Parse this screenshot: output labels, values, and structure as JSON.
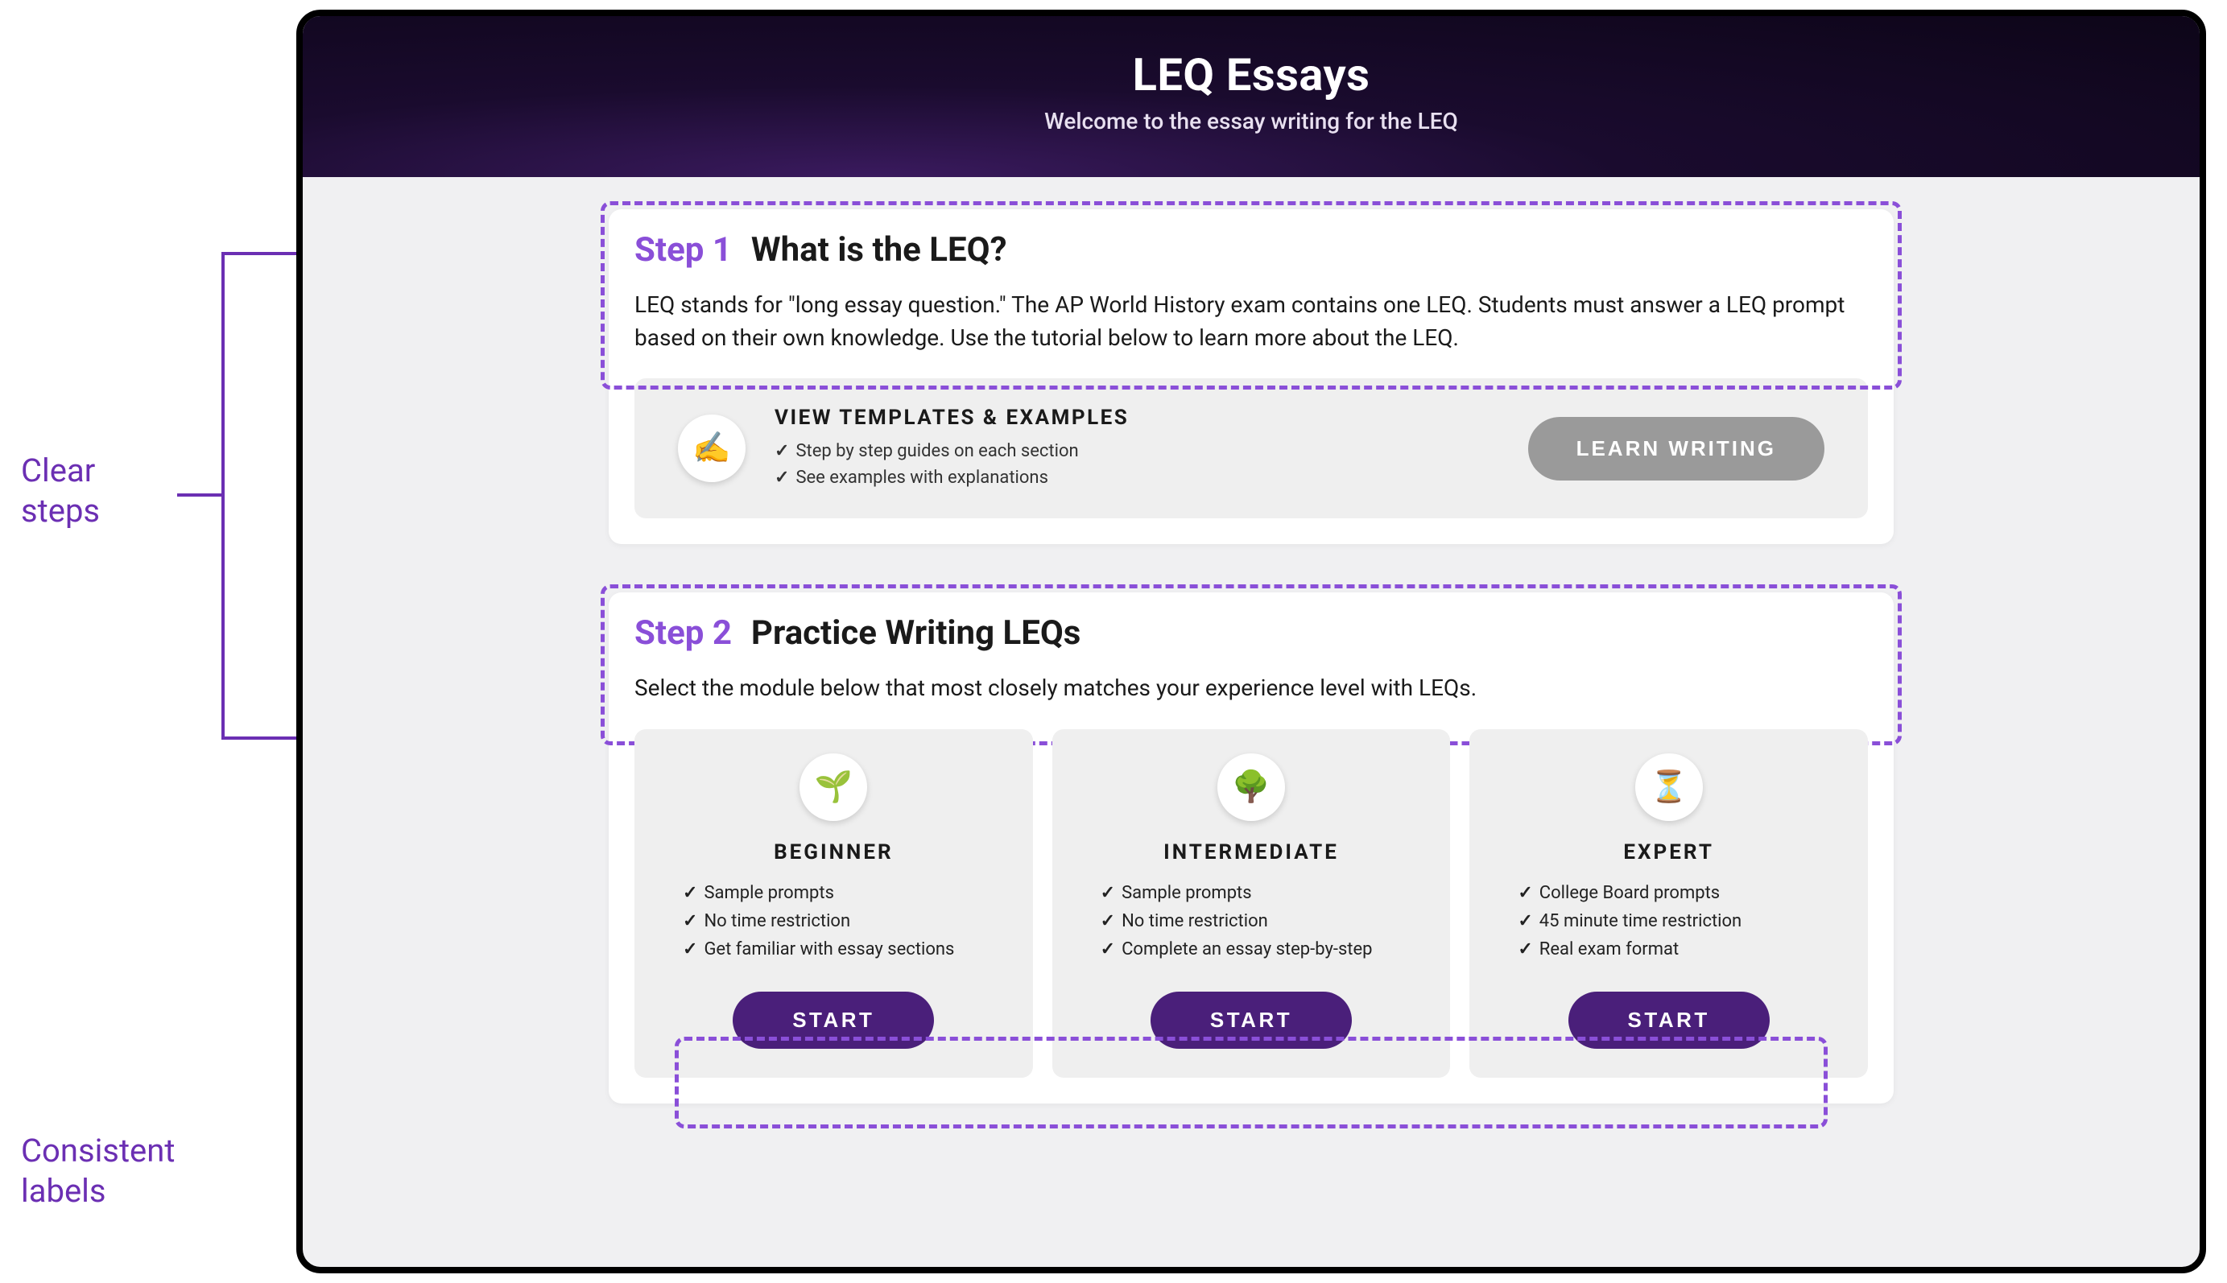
{
  "annotations": {
    "steps_line1": "Clear",
    "steps_line2": "steps",
    "labels_line1": "Consistent",
    "labels_line2": "labels"
  },
  "header": {
    "title": "LEQ Essays",
    "subtitle": "Welcome to the essay writing for the LEQ"
  },
  "step1": {
    "label": "Step 1",
    "title": "What is the LEQ?",
    "desc": "LEQ stands for \"long essay question.\" The AP World History exam contains one LEQ. Students must answer a LEQ prompt based on their own knowledge. Use the tutorial below to learn more about the LEQ.",
    "promo": {
      "icon": "✍️",
      "title": "VIEW TEMPLATES & EXAMPLES",
      "bullet1": "Step by step guides on each section",
      "bullet2": "See examples with explanations",
      "button": "LEARN WRITING"
    }
  },
  "step2": {
    "label": "Step 2",
    "title": "Practice Writing LEQs",
    "desc": "Select the module below that most closely matches your experience level with LEQs.",
    "modules": [
      {
        "icon": "🌱",
        "title": "BEGINNER",
        "bullets": [
          "Sample prompts",
          "No time restriction",
          "Get familiar with essay sections"
        ],
        "button": "START"
      },
      {
        "icon": "🌳",
        "title": "INTERMEDIATE",
        "bullets": [
          "Sample prompts",
          "No time restriction",
          "Complete an essay step-by-step"
        ],
        "button": "START"
      },
      {
        "icon": "⏳",
        "title": "EXPERT",
        "bullets": [
          "College Board prompts",
          "45 minute time restriction",
          "Real exam format"
        ],
        "button": "START"
      }
    ]
  }
}
